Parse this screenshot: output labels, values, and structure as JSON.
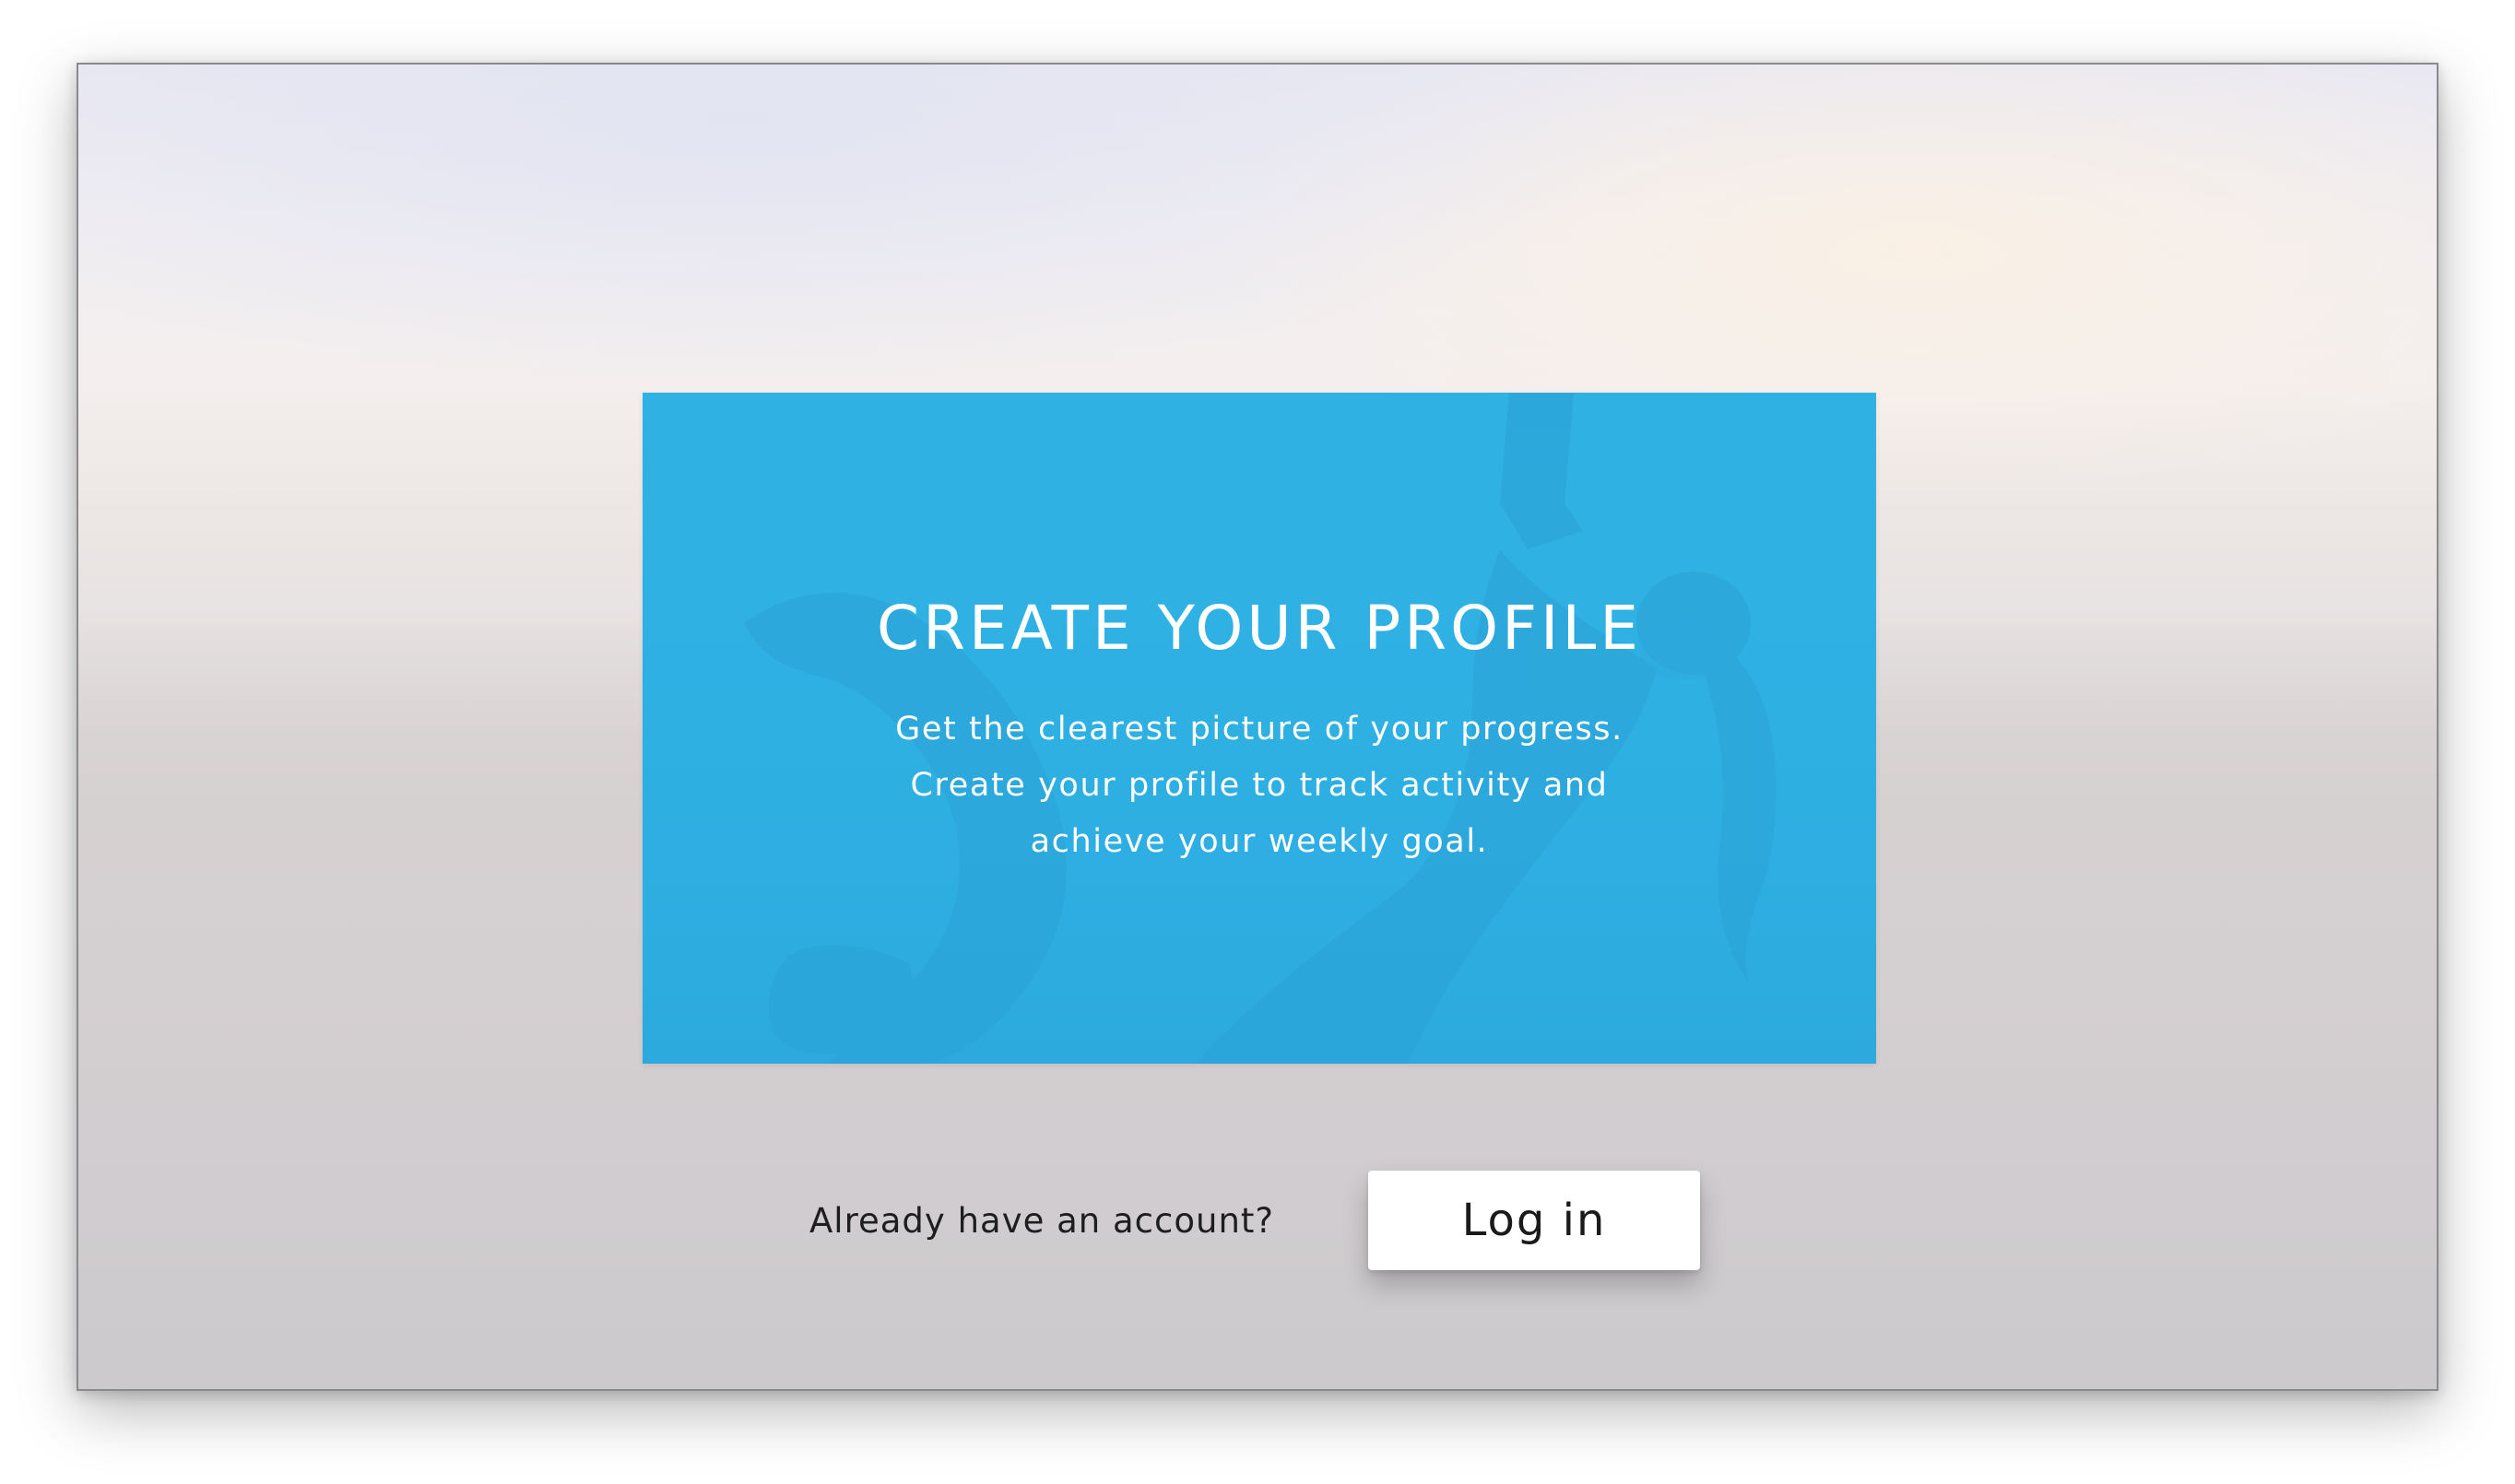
{
  "hero": {
    "title": "CREATE YOUR PROFILE",
    "description_lines": [
      "Get the clearest picture of your progress.",
      "Create your profile to track activity and",
      "achieve your weekly goal."
    ],
    "background_color": "#2fb1e4"
  },
  "login": {
    "prompt": "Already have an account?",
    "button_label": "Log in"
  }
}
